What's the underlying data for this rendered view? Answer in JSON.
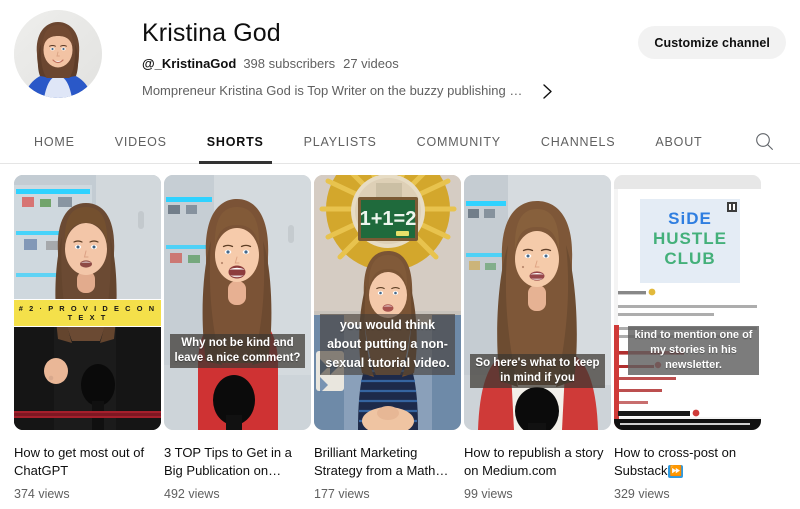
{
  "header": {
    "avatar_alt": "channel-avatar",
    "channel_name": "Kristina God",
    "handle": "@_KristinaGod",
    "subscribers": "398 subscribers",
    "videos": "27 videos",
    "description": "Mompreneur Kristina God is Top Writer on the buzzy publishing platform …",
    "more_icon": "chevron-right-icon",
    "customize_label": "Customize channel"
  },
  "tabs": {
    "items": [
      {
        "label": "HOME",
        "active": false
      },
      {
        "label": "VIDEOS",
        "active": false
      },
      {
        "label": "SHORTS",
        "active": true
      },
      {
        "label": "PLAYLISTS",
        "active": false
      },
      {
        "label": "COMMUNITY",
        "active": false
      },
      {
        "label": "CHANNELS",
        "active": false
      },
      {
        "label": "ABOUT",
        "active": false
      }
    ],
    "search_icon": "search-icon"
  },
  "shorts": [
    {
      "title": "How to get most out of ChatGPT",
      "views": "374 views",
      "banner_text": "# 2 · P R O V I D E   C O N T E X T",
      "caption": ""
    },
    {
      "title": "3 TOP Tips to Get in a Big Publication on…",
      "views": "492 views",
      "caption": "Why not be kind and leave a nice comment?"
    },
    {
      "title": "Brilliant Marketing Strategy from a Math…",
      "views": "177 views",
      "caption": "you would think about putting a non-sexual tutorial video.",
      "chalkboard_text": "1+1=2"
    },
    {
      "title": "How to republish a story on Medium.com",
      "views": "99 views",
      "caption": "So here's what to keep in mind if you"
    },
    {
      "title_prefix": "How to cross-post on Substack",
      "title_glyph": "⏩",
      "views": "329 views",
      "caption": "kind to mention one of my stories in his newsletter.",
      "logo_line1": "SiDE",
      "logo_line2": "HUSTLE",
      "logo_line3": "CLUB"
    }
  ],
  "colors": {
    "accent_yellow": "#f4e04a",
    "text_primary": "#0f0f0f",
    "text_secondary": "#606060",
    "button_bg": "#f2f2f2",
    "substack_blue": "#2f9ae0"
  }
}
